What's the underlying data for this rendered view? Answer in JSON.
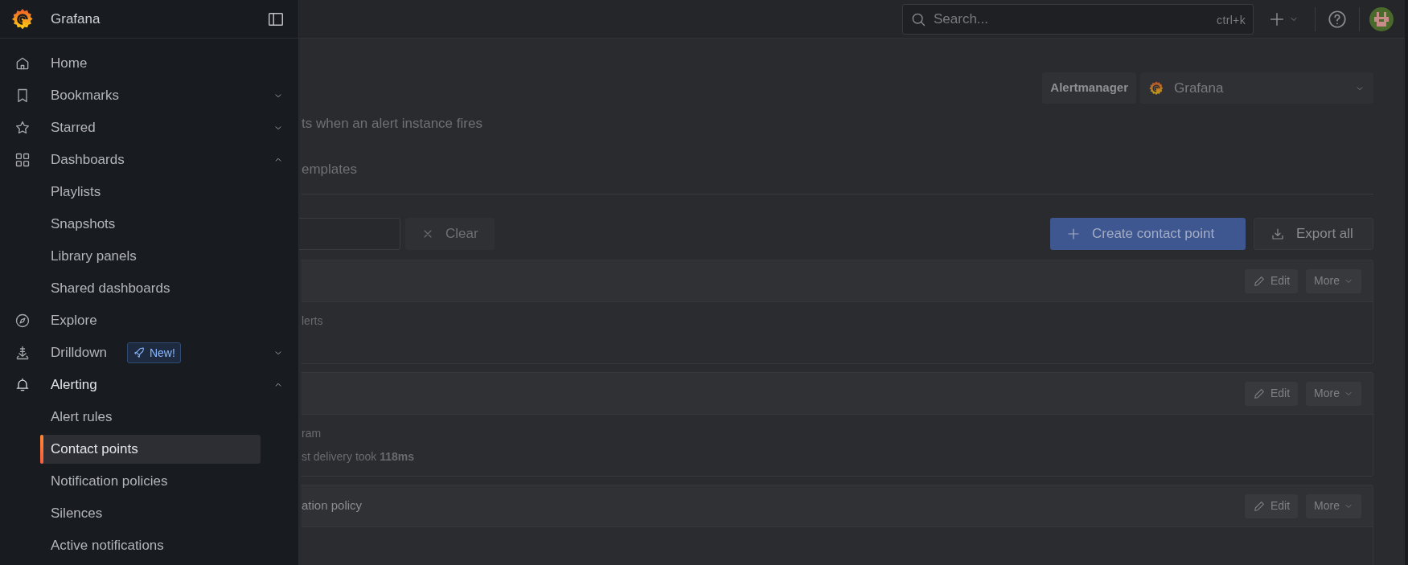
{
  "sidebar": {
    "title": "Grafana",
    "items": [
      {
        "label": "Home",
        "selected": false
      },
      {
        "label": "Bookmarks",
        "selected": false,
        "expanded": false
      },
      {
        "label": "Starred",
        "selected": false,
        "expanded": false
      },
      {
        "label": "Dashboards",
        "selected": false,
        "expanded": true,
        "children": [
          {
            "label": "Playlists",
            "selected": false
          },
          {
            "label": "Snapshots",
            "selected": false
          },
          {
            "label": "Library panels",
            "selected": false
          },
          {
            "label": "Shared dashboards",
            "selected": false
          }
        ]
      },
      {
        "label": "Explore",
        "selected": false
      },
      {
        "label": "Drilldown",
        "selected": false,
        "expanded": false,
        "badge": "New!"
      },
      {
        "label": "Alerting",
        "selected": false,
        "expanded": true,
        "children": [
          {
            "label": "Alert rules",
            "selected": false
          },
          {
            "label": "Contact points",
            "selected": true
          },
          {
            "label": "Notification policies",
            "selected": false
          },
          {
            "label": "Silences",
            "selected": false
          },
          {
            "label": "Active notifications",
            "selected": false
          }
        ]
      }
    ]
  },
  "topbar": {
    "search": {
      "placeholder": "Search...",
      "shortcut": "ctrl+k"
    }
  },
  "page": {
    "alertmanager": {
      "label": "Alertmanager",
      "value": "Grafana"
    },
    "description": "ts when an alert instance fires",
    "tabs": [
      {
        "label": "emplates",
        "selected": false
      }
    ],
    "clear_button": "Clear",
    "create_button": "Create contact point",
    "export_button": "Export all",
    "contact_points": [
      {
        "lines": [
          "lerts"
        ],
        "edit": "Edit",
        "more": "More"
      },
      {
        "lines": [
          "ram",
          "st delivery took **118ms**"
        ],
        "edit": "Edit",
        "more": "More"
      },
      {
        "title": "ation policy",
        "edit": "Edit",
        "more": "More"
      }
    ]
  }
}
